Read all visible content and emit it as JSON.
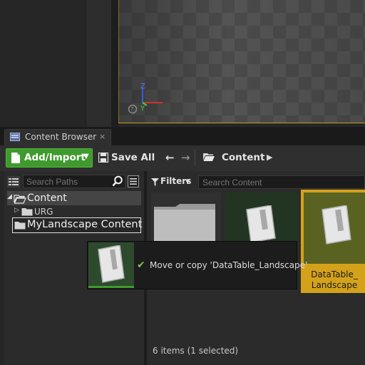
{
  "tab": {
    "label": "Content Browser",
    "close": "×"
  },
  "toolbar": {
    "add_import": "Add/Import",
    "save_all": "Save All",
    "breadcrumb": "Content"
  },
  "left_panel": {
    "search_placeholder": "Search Paths",
    "tree": [
      {
        "label": "Content",
        "expanded": true
      },
      {
        "label": "URG",
        "expanded": false
      },
      {
        "label": "MyLandscape Content"
      }
    ]
  },
  "right_panel": {
    "filters": "Filters",
    "search_placeholder": "Search Content",
    "assets": [
      {
        "label": "",
        "type": "folder"
      },
      {
        "label": "",
        "type": "datatable"
      },
      {
        "label": "DataTable_ Landscape",
        "type": "datatable",
        "selected": true
      }
    ],
    "status": "6 items (1 selected)"
  },
  "drag_tooltip": {
    "message": "Move or copy 'DataTable_Landscape'"
  },
  "viewport": {
    "axis": {
      "z": "Z",
      "y": "Y"
    }
  },
  "colors": {
    "accent_green": "#3f9a2d",
    "selection_gold": "#d4a21a",
    "viewport_border": "#c89a20"
  }
}
